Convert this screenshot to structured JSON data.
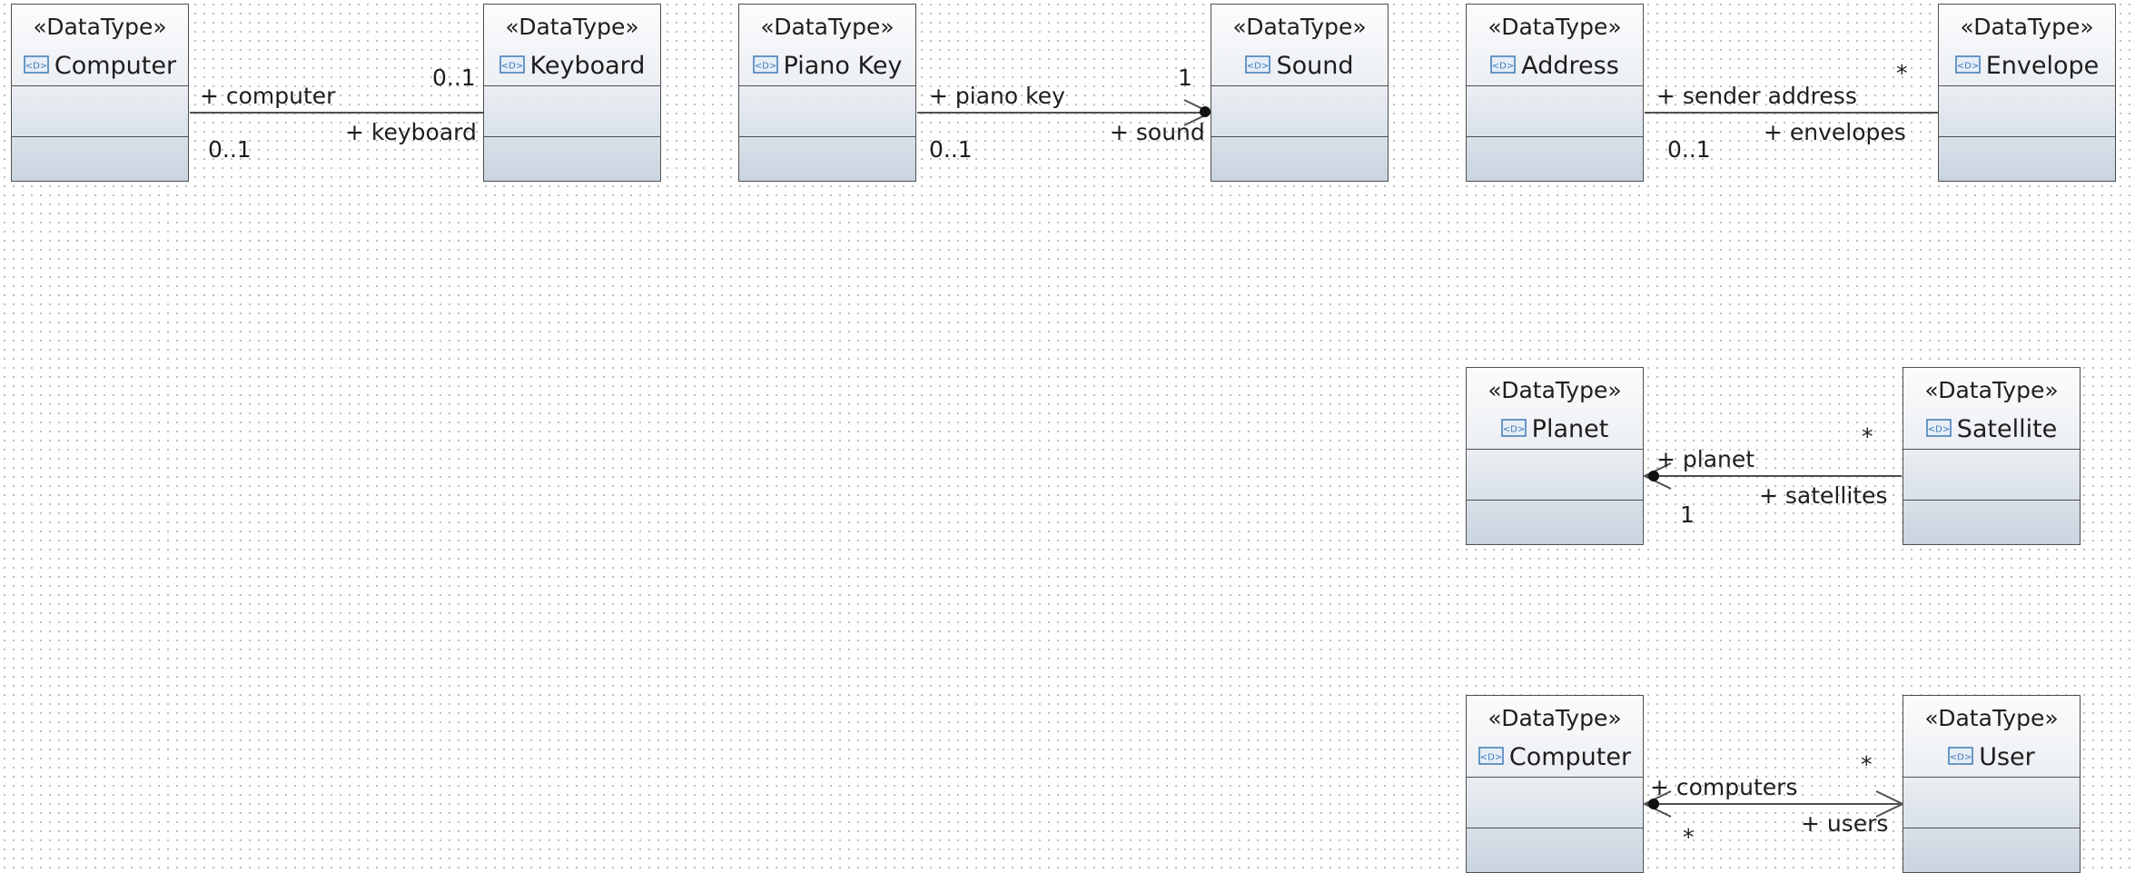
{
  "stereotype": "«DataType»",
  "colors": {
    "line": "#4f4f4f",
    "text": "#1e1e1e",
    "icon": "#3d78b6",
    "box_gradient_top": "#fbfcfd",
    "box_gradient_bottom": "#c9d4df"
  },
  "icons": {
    "datatype": "datatype-icon"
  },
  "classes": [
    {
      "id": "computer-1",
      "name": "Computer"
    },
    {
      "id": "keyboard",
      "name": "Keyboard"
    },
    {
      "id": "piano-key",
      "name": "Piano Key"
    },
    {
      "id": "sound",
      "name": "Sound"
    },
    {
      "id": "address",
      "name": "Address"
    },
    {
      "id": "envelope",
      "name": "Envelope"
    },
    {
      "id": "planet",
      "name": "Planet"
    },
    {
      "id": "satellite",
      "name": "Satellite"
    },
    {
      "id": "computer-2",
      "name": "Computer"
    },
    {
      "id": "user",
      "name": "User"
    }
  ],
  "associations": [
    {
      "id": "computer-keyboard",
      "source": "computer-1",
      "target": "keyboard",
      "source_role": "+ computer",
      "source_multiplicity": "0..1",
      "target_role": "+ keyboard",
      "target_multiplicity": "0..1",
      "navigability": "none"
    },
    {
      "id": "pianokey-sound",
      "source": "piano-key",
      "target": "sound",
      "source_role": "+ piano key",
      "source_multiplicity": "0..1",
      "target_role": "+ sound",
      "target_multiplicity": "1",
      "navigability": "to-target",
      "ownership_end": "target"
    },
    {
      "id": "address-envelope",
      "source": "address",
      "target": "envelope",
      "source_role": "+ sender address",
      "source_multiplicity": "0..1",
      "target_role": "+ envelopes",
      "target_multiplicity": "*",
      "navigability": "none"
    },
    {
      "id": "planet-satellite",
      "source": "planet",
      "target": "satellite",
      "source_role": "+ planet",
      "source_multiplicity": "1",
      "target_role": "+ satellites",
      "target_multiplicity": "*",
      "navigability": "to-source",
      "ownership_end": "source"
    },
    {
      "id": "computer-user",
      "source": "computer-2",
      "target": "user",
      "source_role": "+ computers",
      "source_multiplicity": "*",
      "target_role": "+ users",
      "target_multiplicity": "*",
      "navigability": "both",
      "ownership_end": "source"
    }
  ]
}
